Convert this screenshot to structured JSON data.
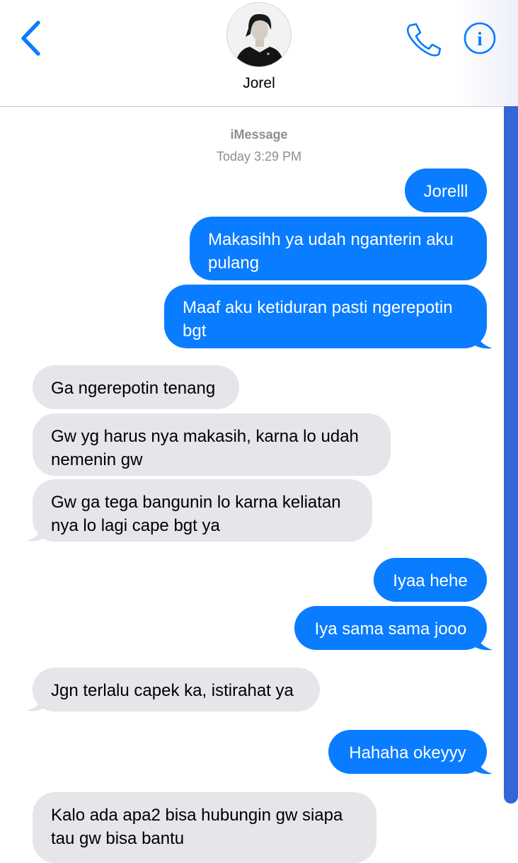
{
  "header": {
    "contact_name": "Jorel",
    "back_icon": "chevron-left-icon",
    "call_icon": "phone-icon",
    "info_icon": "info-icon",
    "accent_color": "#0a7cff"
  },
  "conversation": {
    "service": "iMessage",
    "timestamp": "Today 3:29 PM",
    "sent_color": "#0a7cff",
    "received_color": "#e5e5ea",
    "messages": [
      {
        "from": "me",
        "text": "Jorelll"
      },
      {
        "from": "me",
        "text": "Makasihh ya udah nganterin aku pulang"
      },
      {
        "from": "me",
        "text": "Maaf aku ketiduran pasti ngerepotin bgt"
      },
      {
        "from": "them",
        "text": "Ga ngerepotin tenang"
      },
      {
        "from": "them",
        "text": "Gw yg harus nya makasih, karna lo udah nemenin gw"
      },
      {
        "from": "them",
        "text": "Gw ga tega bangunin lo karna keliatan nya lo lagi cape bgt ya"
      },
      {
        "from": "me",
        "text": "Iyaa hehe"
      },
      {
        "from": "me",
        "text": "Iya sama sama jooo"
      },
      {
        "from": "them",
        "text": "Jgn terlalu capek ka, istirahat ya"
      },
      {
        "from": "me",
        "text": "Hahaha okeyyy"
      },
      {
        "from": "them",
        "text": "Kalo ada apa2 bisa hubungin gw siapa tau gw bisa bantu"
      }
    ]
  }
}
